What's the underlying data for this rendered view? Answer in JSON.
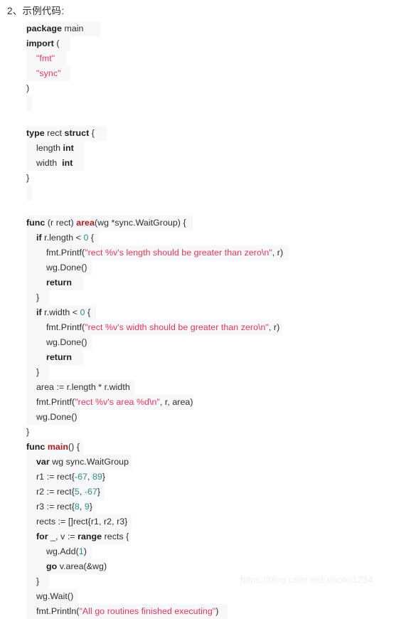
{
  "page": {
    "heading": "2、示例代码:",
    "watermark": "https://blog.csdn.net/xiaotai1234",
    "language": "go",
    "colors": {
      "background": "#ffffff",
      "text": "#2d2d2d",
      "keyword": "#1d1d1d",
      "function": "#b01919",
      "string": "#e8335a",
      "number": "#2e8b8b",
      "line_shade": "#f7f8f9",
      "watermark": "#efefef"
    }
  },
  "code": {
    "lines": [
      {
        "n": 1,
        "indent": 0,
        "shade": 104,
        "text": "package main",
        "tokens": [
          {
            "t": "package",
            "c": "kw"
          },
          {
            "t": " main",
            "c": "pln"
          }
        ]
      },
      {
        "n": 2,
        "indent": 0,
        "shade": 62,
        "text": "import (",
        "tokens": [
          {
            "t": "import",
            "c": "kw"
          },
          {
            "t": " (",
            "c": "punc"
          }
        ]
      },
      {
        "n": 3,
        "indent": 1,
        "shade": 56,
        "text": "    \"fmt\"",
        "tokens": [
          {
            "t": "    ",
            "c": "pln"
          },
          {
            "t": "\"fmt\"",
            "c": "str"
          }
        ]
      },
      {
        "n": 4,
        "indent": 1,
        "shade": 62,
        "text": "    \"sync\"",
        "tokens": [
          {
            "t": "    ",
            "c": "pln"
          },
          {
            "t": "\"sync\"",
            "c": "str"
          }
        ]
      },
      {
        "n": 5,
        "indent": 0,
        "shade": 0,
        "text": ")",
        "tokens": [
          {
            "t": ")",
            "c": "punc"
          }
        ]
      },
      {
        "n": 6,
        "indent": 0,
        "shade": 8,
        "text": "",
        "tokens": []
      },
      {
        "n": 7,
        "indent": 0,
        "shade": 0,
        "text": "",
        "tokens": []
      },
      {
        "n": 8,
        "indent": 0,
        "shade": 113,
        "text": "type rect struct {",
        "tokens": [
          {
            "t": "type",
            "c": "kw"
          },
          {
            "t": " rect ",
            "c": "pln"
          },
          {
            "t": "struct",
            "c": "kw"
          },
          {
            "t": " {",
            "c": "punc"
          }
        ]
      },
      {
        "n": 9,
        "indent": 1,
        "shade": 81,
        "text": "    length int",
        "tokens": [
          {
            "t": "    length ",
            "c": "pln"
          },
          {
            "t": "int",
            "c": "kw"
          }
        ]
      },
      {
        "n": 10,
        "indent": 1,
        "shade": 81,
        "text": "    width  int",
        "tokens": [
          {
            "t": "    width  ",
            "c": "pln"
          },
          {
            "t": "int",
            "c": "kw"
          }
        ]
      },
      {
        "n": 11,
        "indent": 0,
        "shade": 0,
        "text": "}",
        "tokens": [
          {
            "t": "}",
            "c": "punc"
          }
        ]
      },
      {
        "n": 12,
        "indent": 0,
        "shade": 8,
        "text": "",
        "tokens": []
      },
      {
        "n": 13,
        "indent": 0,
        "shade": 0,
        "text": "",
        "tokens": []
      },
      {
        "n": 14,
        "indent": 0,
        "shade": 234,
        "text": "func (r rect) area(wg *sync.WaitGroup) {",
        "tokens": [
          {
            "t": "func",
            "c": "kw"
          },
          {
            "t": " (r rect) ",
            "c": "pln"
          },
          {
            "t": "area",
            "c": "fn"
          },
          {
            "t": "(wg *sync.WaitGroup) {",
            "c": "pln"
          }
        ]
      },
      {
        "n": 15,
        "indent": 1,
        "shade": 101,
        "text": "    if r.length < 0 {",
        "tokens": [
          {
            "t": "    ",
            "c": "pln"
          },
          {
            "t": "if",
            "c": "kw"
          },
          {
            "t": " r.length < ",
            "c": "pln"
          },
          {
            "t": "0",
            "c": "num"
          },
          {
            "t": " {",
            "c": "punc"
          }
        ]
      },
      {
        "n": 16,
        "indent": 2,
        "shade": 369,
        "text": "        fmt.Printf(\"rect %v's length should be greater than zero\\n\", r)",
        "tokens": [
          {
            "t": "        fmt.Printf(",
            "c": "pln"
          },
          {
            "t": "\"rect %v's length should be greater than zero\\n\"",
            "c": "str"
          },
          {
            "t": ", r)",
            "c": "pln"
          }
        ]
      },
      {
        "n": 17,
        "indent": 2,
        "shade": 92,
        "text": "        wg.Done()",
        "tokens": [
          {
            "t": "        wg.Done()",
            "c": "pln"
          }
        ]
      },
      {
        "n": 18,
        "indent": 2,
        "shade": 80,
        "text": "        return",
        "tokens": [
          {
            "t": "        ",
            "c": "pln"
          },
          {
            "t": "return",
            "c": "kw"
          }
        ]
      },
      {
        "n": 19,
        "indent": 1,
        "shade": 32,
        "text": "    }",
        "tokens": [
          {
            "t": "    }",
            "c": "punc"
          }
        ]
      },
      {
        "n": 20,
        "indent": 1,
        "shade": 98,
        "text": "    if r.width < 0 {",
        "tokens": [
          {
            "t": "    ",
            "c": "pln"
          },
          {
            "t": "if",
            "c": "kw"
          },
          {
            "t": " r.width < ",
            "c": "pln"
          },
          {
            "t": "0",
            "c": "num"
          },
          {
            "t": " {",
            "c": "punc"
          }
        ]
      },
      {
        "n": 21,
        "indent": 2,
        "shade": 360,
        "text": "        fmt.Printf(\"rect %v's width should be greater than zero\\n\", r)",
        "tokens": [
          {
            "t": "        fmt.Printf(",
            "c": "pln"
          },
          {
            "t": "\"rect %v's width should be greater than zero\\n\"",
            "c": "str"
          },
          {
            "t": ", r)",
            "c": "pln"
          }
        ]
      },
      {
        "n": 22,
        "indent": 2,
        "shade": 92,
        "text": "        wg.Done()",
        "tokens": [
          {
            "t": "        wg.Done()",
            "c": "pln"
          }
        ]
      },
      {
        "n": 23,
        "indent": 2,
        "shade": 80,
        "text": "        return",
        "tokens": [
          {
            "t": "        ",
            "c": "pln"
          },
          {
            "t": "return",
            "c": "kw"
          }
        ]
      },
      {
        "n": 24,
        "indent": 1,
        "shade": 32,
        "text": "    }",
        "tokens": [
          {
            "t": "    }",
            "c": "punc"
          }
        ]
      },
      {
        "n": 25,
        "indent": 1,
        "shade": 152,
        "text": "    area := r.length * r.width",
        "tokens": [
          {
            "t": "    area := r.length * r.width",
            "c": "pln"
          }
        ]
      },
      {
        "n": 26,
        "indent": 1,
        "shade": 235,
        "text": "    fmt.Printf(\"rect %v's area %d\\n\", r, area)",
        "tokens": [
          {
            "t": "    fmt.Printf(",
            "c": "pln"
          },
          {
            "t": "\"rect %v's area %d\\n\"",
            "c": "str"
          },
          {
            "t": ", r, area)",
            "c": "pln"
          }
        ]
      },
      {
        "n": 27,
        "indent": 1,
        "shade": 75,
        "text": "    wg.Done()",
        "tokens": [
          {
            "t": "    wg.Done()",
            "c": "pln"
          }
        ]
      },
      {
        "n": 28,
        "indent": 0,
        "shade": 0,
        "text": "}",
        "tokens": [
          {
            "t": "}",
            "c": "punc"
          }
        ]
      },
      {
        "n": 29,
        "indent": 0,
        "shade": 80,
        "text": "func main() {",
        "tokens": [
          {
            "t": "func",
            "c": "kw"
          },
          {
            "t": " ",
            "c": "pln"
          },
          {
            "t": "main",
            "c": "fn"
          },
          {
            "t": "() {",
            "c": "punc"
          }
        ]
      },
      {
        "n": 30,
        "indent": 1,
        "shade": 148,
        "text": "    var wg sync.WaitGroup",
        "tokens": [
          {
            "t": "    ",
            "c": "pln"
          },
          {
            "t": "var",
            "c": "kw"
          },
          {
            "t": " wg sync.WaitGroup",
            "c": "pln"
          }
        ]
      },
      {
        "n": 31,
        "indent": 1,
        "shade": 110,
        "text": "    r1 := rect{-67, 89}",
        "tokens": [
          {
            "t": "    r1 := rect{",
            "c": "pln"
          },
          {
            "t": "-67",
            "c": "num"
          },
          {
            "t": ", ",
            "c": "pln"
          },
          {
            "t": "89",
            "c": "num"
          },
          {
            "t": "}",
            "c": "punc"
          }
        ]
      },
      {
        "n": 32,
        "indent": 1,
        "shade": 110,
        "text": "    r2 := rect{5, -67}",
        "tokens": [
          {
            "t": "    r2 := rect{",
            "c": "pln"
          },
          {
            "t": "5",
            "c": "num"
          },
          {
            "t": ", ",
            "c": "pln"
          },
          {
            "t": "-67",
            "c": "num"
          },
          {
            "t": "}",
            "c": "punc"
          }
        ]
      },
      {
        "n": 33,
        "indent": 1,
        "shade": 98,
        "text": "    r3 := rect{8, 9}",
        "tokens": [
          {
            "t": "    r3 := rect{",
            "c": "pln"
          },
          {
            "t": "8",
            "c": "num"
          },
          {
            "t": ", ",
            "c": "pln"
          },
          {
            "t": "9",
            "c": "num"
          },
          {
            "t": "}",
            "c": "punc"
          }
        ]
      },
      {
        "n": 34,
        "indent": 1,
        "shade": 148,
        "text": "    rects := []rect{r1, r2, r3}",
        "tokens": [
          {
            "t": "    rects := []rect{r1, r2, r3}",
            "c": "pln"
          }
        ]
      },
      {
        "n": 35,
        "indent": 1,
        "shade": 140,
        "text": "    for _, v := range rects {",
        "tokens": [
          {
            "t": "    ",
            "c": "pln"
          },
          {
            "t": "for",
            "c": "kw"
          },
          {
            "t": " _, v := ",
            "c": "pln"
          },
          {
            "t": "range",
            "c": "kw"
          },
          {
            "t": " rects {",
            "c": "pln"
          }
        ]
      },
      {
        "n": 36,
        "indent": 2,
        "shade": 92,
        "text": "        wg.Add(1)",
        "tokens": [
          {
            "t": "        wg.Add(",
            "c": "pln"
          },
          {
            "t": "1",
            "c": "num"
          },
          {
            "t": ")",
            "c": "punc"
          }
        ]
      },
      {
        "n": 37,
        "indent": 2,
        "shade": 110,
        "text": "        go v.area(&wg)",
        "tokens": [
          {
            "t": "        ",
            "c": "pln"
          },
          {
            "t": "go",
            "c": "kw"
          },
          {
            "t": " v.area(&wg)",
            "c": "pln"
          }
        ]
      },
      {
        "n": 38,
        "indent": 1,
        "shade": 32,
        "text": "    }",
        "tokens": [
          {
            "t": "    }",
            "c": "punc"
          }
        ]
      },
      {
        "n": 39,
        "indent": 1,
        "shade": 72,
        "text": "    wg.Wait()",
        "tokens": [
          {
            "t": "    wg.Wait()",
            "c": "pln"
          }
        ]
      },
      {
        "n": 40,
        "indent": 1,
        "shade": 283,
        "text": "    fmt.Println(\"All go routines finished executing\")",
        "tokens": [
          {
            "t": "    fmt.Println(",
            "c": "pln"
          },
          {
            "t": "\"All go routines finished executing\"",
            "c": "str"
          },
          {
            "t": ")",
            "c": "punc"
          }
        ]
      }
    ]
  }
}
